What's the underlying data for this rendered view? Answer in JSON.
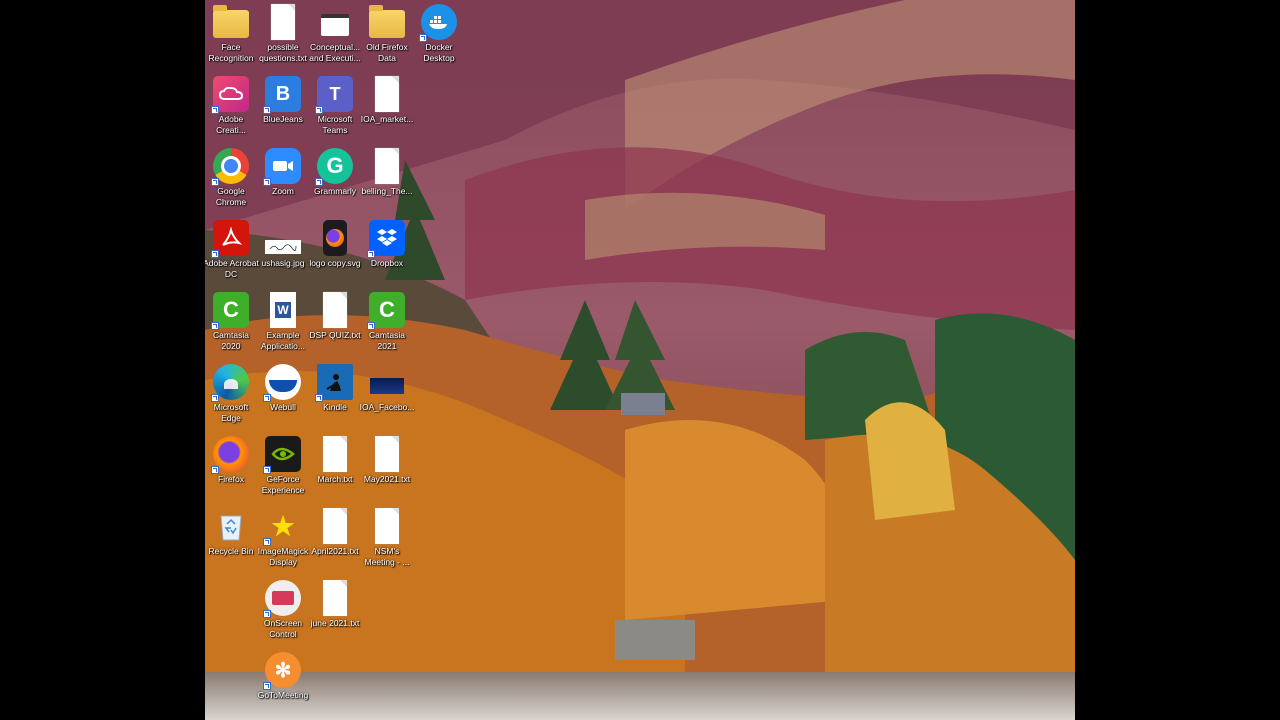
{
  "desktop": {
    "icons": [
      {
        "label": "Face Recognition",
        "icon": "folder-icon"
      },
      {
        "label": "possible questions.txt",
        "icon": "text-file-icon"
      },
      {
        "label": "Conceptual... and Executi...",
        "icon": "document-icon"
      },
      {
        "label": "Old Firefox Data",
        "icon": "folder-icon"
      },
      {
        "label": "Docker Desktop",
        "icon": "docker-icon"
      },
      {
        "label": "Adobe Creati...",
        "icon": "adobe-creative-cloud-icon"
      },
      {
        "label": "BlueJeans",
        "icon": "bluejeans-icon"
      },
      {
        "label": "Microsoft Teams",
        "icon": "teams-icon"
      },
      {
        "label": "IOA_market...",
        "icon": "text-file-icon"
      },
      {
        "label": "Google Chrome",
        "icon": "chrome-icon"
      },
      {
        "label": "Zoom",
        "icon": "zoom-icon"
      },
      {
        "label": "Grammarly",
        "icon": "grammarly-icon"
      },
      {
        "label": "belling_The...",
        "icon": "text-file-icon"
      },
      {
        "label": "Adobe Acrobat DC",
        "icon": "acrobat-icon"
      },
      {
        "label": "ushasig.jpg",
        "icon": "image-file-icon"
      },
      {
        "label": "logo copy.svg",
        "icon": "firefox-icon"
      },
      {
        "label": "Dropbox",
        "icon": "dropbox-icon"
      },
      {
        "label": "Camtasia 2020",
        "icon": "camtasia-icon"
      },
      {
        "label": "Example Applicatio...",
        "icon": "word-icon"
      },
      {
        "label": "DSP QUIZ.txt",
        "icon": "text-file-icon"
      },
      {
        "label": "Camtasia 2021",
        "icon": "camtasia-icon"
      },
      {
        "label": "Microsoft Edge",
        "icon": "edge-icon"
      },
      {
        "label": "Webull",
        "icon": "webull-icon"
      },
      {
        "label": "Kindle",
        "icon": "kindle-icon"
      },
      {
        "label": "IOA_Facebo...",
        "icon": "image-file-icon"
      },
      {
        "label": "Firefox",
        "icon": "firefox-icon"
      },
      {
        "label": "GeForce Experience",
        "icon": "geforce-icon"
      },
      {
        "label": "March.txt",
        "icon": "text-file-icon"
      },
      {
        "label": "May2021.txt",
        "icon": "text-file-icon"
      },
      {
        "label": "Recycle Bin",
        "icon": "recycle-bin-icon"
      },
      {
        "label": "ImageMagick Display",
        "icon": "imagemagick-icon"
      },
      {
        "label": "April2021.txt",
        "icon": "text-file-icon"
      },
      {
        "label": "NSM's Meeting - ...",
        "icon": "text-file-icon"
      },
      {
        "label": "OnScreen Control",
        "icon": "onscreen-control-icon"
      },
      {
        "label": "june 2021.txt",
        "icon": "text-file-icon"
      },
      {
        "label": "GoToMeeting",
        "icon": "gotomeeting-icon"
      }
    ]
  }
}
